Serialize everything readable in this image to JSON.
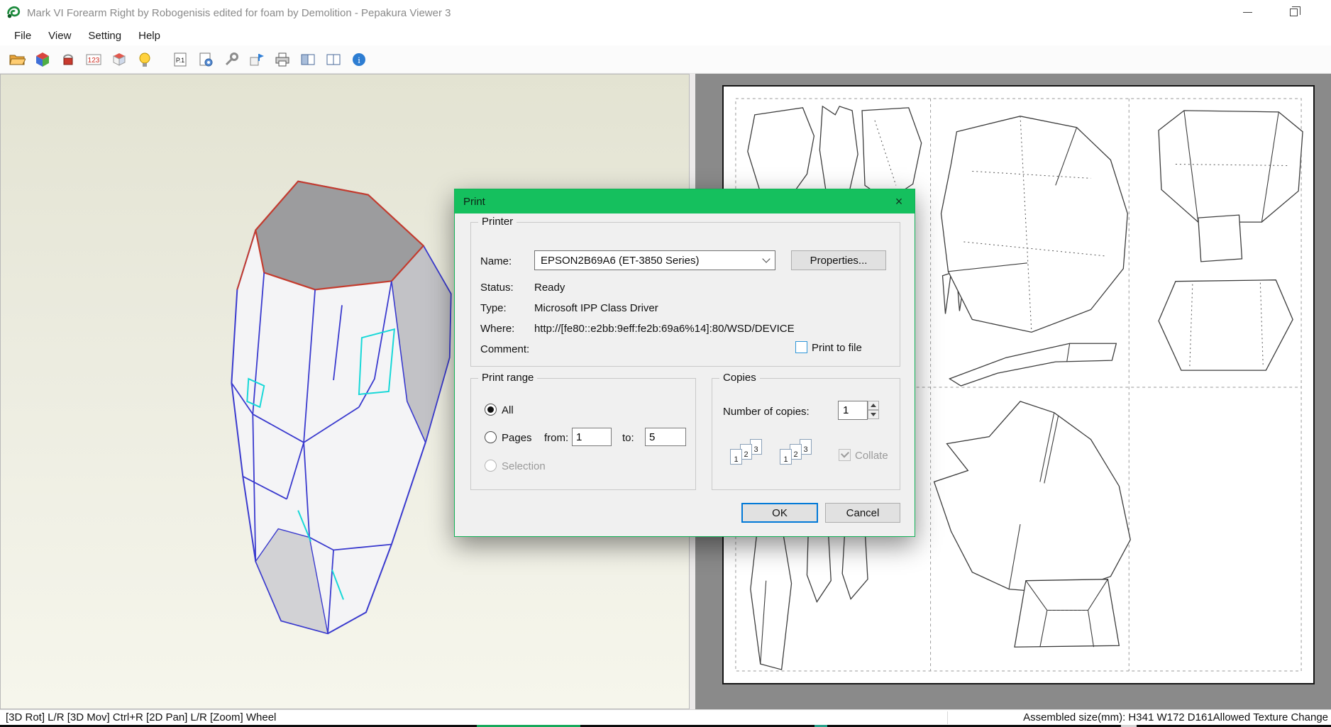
{
  "window": {
    "title": "Mark VI Forearm Right by Robogenisis edited for foam by Demolition - Pepakura Viewer 3"
  },
  "menu": {
    "items": [
      {
        "label": "File"
      },
      {
        "label": "View"
      },
      {
        "label": "Setting"
      },
      {
        "label": "Help"
      }
    ]
  },
  "toolbar": {
    "icons": [
      "open-file-icon",
      "show-3d-cube-icon",
      "texture-paint-icon",
      "edge-id-icon",
      "flaps-cube-icon",
      "light-icon",
      "page-number-icon",
      "print-setting-icon",
      "wrench-icon",
      "pick-part-icon",
      "print-icon",
      "layout-left-icon",
      "layout-both-icon",
      "info-icon"
    ],
    "edge_id_label": "123",
    "p1_label": "P.1",
    "info_glyph": "i"
  },
  "dialog": {
    "title": "Print",
    "printer": {
      "group_label": "Printer",
      "name_label": "Name:",
      "name_value": "EPSON2B69A6 (ET-3850 Series)",
      "properties_label": "Properties...",
      "status_label": "Status:",
      "status_value": "Ready",
      "type_label": "Type:",
      "type_value": "Microsoft IPP Class Driver",
      "where_label": "Where:",
      "where_value": "http://[fe80::e2bb:9eff:fe2b:69a6%14]:80/WSD/DEVICE",
      "comment_label": "Comment:",
      "print_to_file_label": "Print to file"
    },
    "print_range": {
      "group_label": "Print range",
      "all_label": "All",
      "pages_label": "Pages",
      "from_label": "from:",
      "from_value": "1",
      "to_label": "to:",
      "to_value": "5",
      "selection_label": "Selection"
    },
    "copies": {
      "group_label": "Copies",
      "number_label": "Number of copies:",
      "number_value": "1",
      "collate_label": "Collate",
      "collate_numbers": [
        "1",
        "2",
        "3"
      ]
    },
    "ok_label": "OK",
    "cancel_label": "Cancel"
  },
  "statusbar": {
    "left": "[3D Rot] L/R [3D Mov] Ctrl+R [2D Pan] L/R [Zoom] Wheel",
    "assembled": "Assembled size(mm): H341 W172 D161",
    "texture": "Allowed Texture Change"
  },
  "colors": {
    "dialog_accent": "#15c05e",
    "default_button_border": "#0078d7",
    "pane_2d_background": "#8a8a8a"
  }
}
